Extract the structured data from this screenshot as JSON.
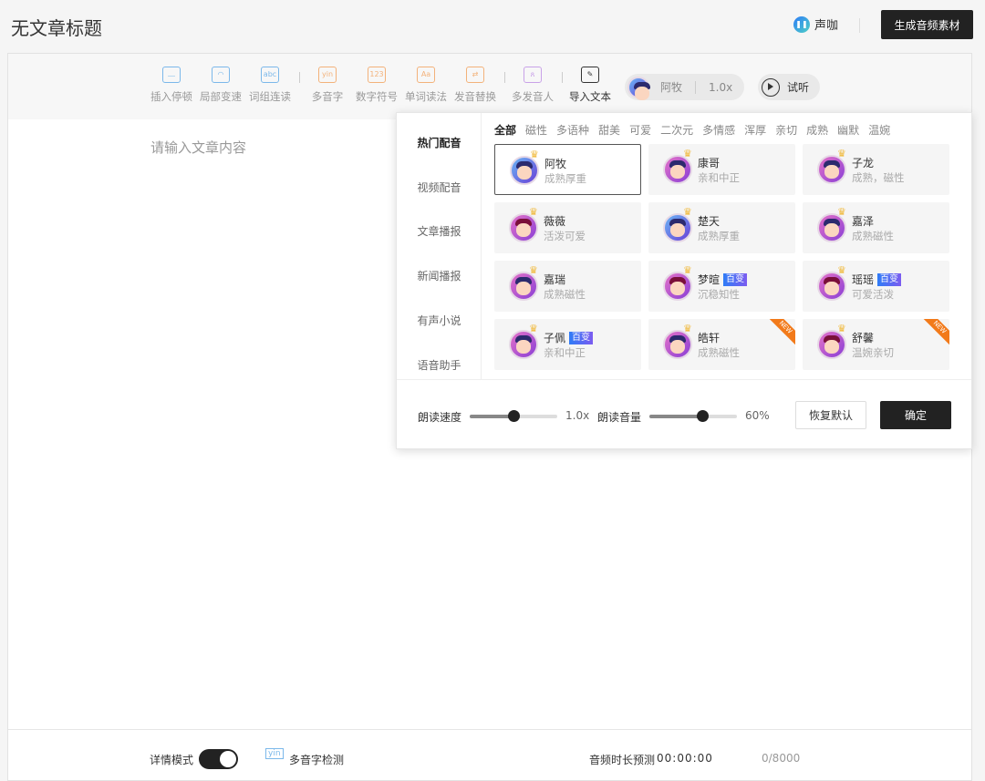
{
  "header": {
    "title": "无文章标题",
    "brand": "声咖",
    "generate_label": "生成音频素材"
  },
  "toolbar": {
    "tools": [
      {
        "label": "插入停顿",
        "icon": "pause-insert-icon",
        "glyph": "⎼",
        "color": "#7bb8ea"
      },
      {
        "label": "局部变速",
        "icon": "speedometer-icon",
        "glyph": "◠",
        "color": "#7bb8ea"
      },
      {
        "label": "词组连读",
        "icon": "abc-icon",
        "glyph": "abc",
        "color": "#7bb8ea"
      },
      {
        "label": "多音字",
        "icon": "yin-icon",
        "glyph": "yin",
        "color": "#f3b27a"
      },
      {
        "label": "数字符号",
        "icon": "number-icon",
        "glyph": "123",
        "color": "#f3b27a"
      },
      {
        "label": "单词读法",
        "icon": "word-icon",
        "glyph": "Aa",
        "color": "#f3b27a"
      },
      {
        "label": "发音替换",
        "icon": "replace-icon",
        "glyph": "⇄",
        "color": "#f3b27a"
      },
      {
        "label": "多发音人",
        "icon": "multi-speaker-icon",
        "glyph": "ጸ",
        "color": "#c9a2e8"
      },
      {
        "label": "导入文本",
        "icon": "import-text-icon",
        "glyph": "✎",
        "color": "#333"
      }
    ],
    "voice": {
      "name": "阿牧",
      "speed": "1.0x"
    },
    "listen_label": "试听"
  },
  "editor": {
    "placeholder": "请输入文章内容"
  },
  "bottom": {
    "detail_mode": "详情模式",
    "detail_mode_on": true,
    "polyphone_check": "多音字检测",
    "duration_label": "音频时长预测",
    "duration": "00:00:00",
    "char_count": "0/8000"
  },
  "popup": {
    "nav": [
      "热门配音",
      "视频配音",
      "文章播报",
      "新闻播报",
      "有声小说",
      "语音助手"
    ],
    "tags": [
      "全部",
      "磁性",
      "多语种",
      "甜美",
      "可爱",
      "二次元",
      "多情感",
      "浑厚",
      "亲切",
      "成熟",
      "幽默",
      "温婉"
    ],
    "voices": [
      {
        "name": "阿牧",
        "desc": "成熟厚重",
        "selected": true,
        "style": "blue",
        "badge": "",
        "isNew": false
      },
      {
        "name": "康哥",
        "desc": "亲和中正",
        "style": "m",
        "badge": "",
        "isNew": false
      },
      {
        "name": "子龙",
        "desc": "成熟，磁性",
        "style": "m",
        "badge": "",
        "isNew": false
      },
      {
        "name": "薇薇",
        "desc": "活泼可爱",
        "style": "f",
        "badge": "",
        "isNew": false
      },
      {
        "name": "楚天",
        "desc": "成熟厚重",
        "style": "blue",
        "badge": "",
        "isNew": false
      },
      {
        "name": "嘉泽",
        "desc": "成熟磁性",
        "style": "m",
        "badge": "",
        "isNew": false
      },
      {
        "name": "嘉瑞",
        "desc": "成熟磁性",
        "style": "m",
        "badge": "",
        "isNew": false
      },
      {
        "name": "梦暄",
        "desc": "沉稳知性",
        "style": "f",
        "badge": "百变",
        "isNew": false
      },
      {
        "name": "瑶瑶",
        "desc": "可爱活泼",
        "style": "f",
        "badge": "百变",
        "isNew": false
      },
      {
        "name": "子佩",
        "desc": "亲和中正",
        "style": "m",
        "badge": "百变",
        "isNew": false
      },
      {
        "name": "皓轩",
        "desc": "成熟磁性",
        "style": "m",
        "badge": "",
        "isNew": true
      },
      {
        "name": "舒馨",
        "desc": "温婉亲切",
        "style": "f",
        "badge": "",
        "isNew": true
      }
    ],
    "new_label": "NEW",
    "speed_label": "朗读速度",
    "speed_value": "1.0x",
    "speed_fraction": 0.5,
    "volume_label": "朗读音量",
    "volume_value": "60%",
    "volume_fraction": 0.6,
    "reset_label": "恢复默认",
    "confirm_label": "确定"
  }
}
